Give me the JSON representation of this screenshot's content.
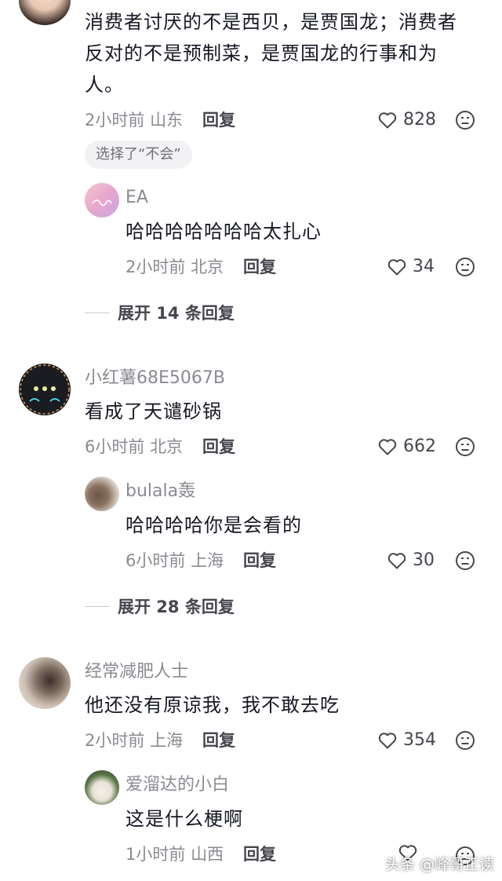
{
  "comments": [
    {
      "text_lines": [
        "消费者讨厌的不是西贝，是贾国龙；消费者",
        "反对的不是预制菜，是贾国龙的行事和为",
        "人。"
      ],
      "time": "2小时前",
      "location": "山东",
      "reply_label": "回复",
      "likes": "828",
      "tag": "选择了“不会”",
      "sub_reply": {
        "name": "EA",
        "text": "哈哈哈哈哈哈哈太扎心",
        "time": "2小时前",
        "location": "北京",
        "reply_label": "回复",
        "likes": "34"
      },
      "expand_label": "展开 14 条回复"
    },
    {
      "name": "小红薯68E5067B",
      "text": "看成了天谴砂锅",
      "time": "6小时前",
      "location": "北京",
      "reply_label": "回复",
      "likes": "662",
      "sub_reply": {
        "name": "bulala轰",
        "text": "哈哈哈哈你是会看的",
        "time": "6小时前",
        "location": "上海",
        "reply_label": "回复",
        "likes": "30"
      },
      "expand_label": "展开 28 条回复"
    },
    {
      "name": "经常减肥人士",
      "text": "他还没有原谅我，我不敢去吃",
      "time": "2小时前",
      "location": "上海",
      "reply_label": "回复",
      "likes": "354",
      "sub_reply": {
        "name": "爱溜达的小白",
        "text": "这是什么梗啊",
        "time": "1小时前",
        "location": "山西",
        "reply_label": "回复",
        "likes": ""
      }
    }
  ],
  "watermark": "头条 @峰哥正读",
  "icons": {
    "like": "heart-outline-icon",
    "dislike": "dislike-face-icon"
  }
}
